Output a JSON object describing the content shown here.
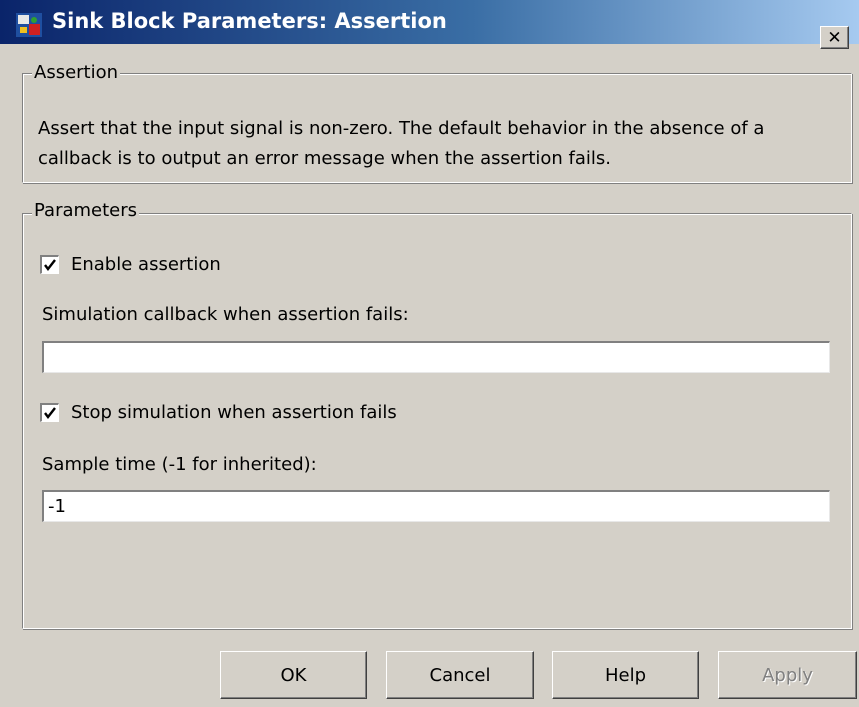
{
  "window": {
    "title": "Sink Block Parameters: Assertion",
    "close_glyph": "✕"
  },
  "assertion_group": {
    "legend": "Assertion",
    "description": "Assert that the input signal is non-zero.  The default behavior in the absence of a\ncallback is to output an error message when the assertion fails."
  },
  "parameters_group": {
    "legend": "Parameters",
    "enable_assertion": {
      "label": "Enable assertion",
      "checked": true
    },
    "callback_label": "Simulation callback when assertion fails:",
    "callback_value": "",
    "stop_simulation": {
      "label": "Stop simulation when assertion fails",
      "checked": true
    },
    "sample_time_label": "Sample time (-1 for inherited):",
    "sample_time_value": "-1"
  },
  "buttons": {
    "ok": "OK",
    "cancel": "Cancel",
    "help": "Help",
    "apply": "Apply",
    "apply_enabled": false
  },
  "icons": {
    "app": "simulink-block-icon",
    "close": "close-icon",
    "check": "checkmark-icon"
  },
  "colors": {
    "titlebar_start": "#0a246a",
    "titlebar_end": "#a6caf0",
    "dialog_face": "#d4d0c8"
  }
}
